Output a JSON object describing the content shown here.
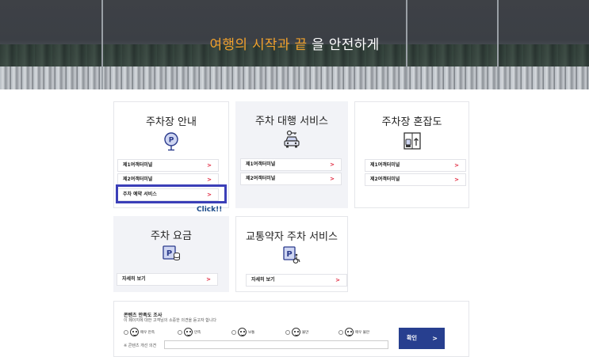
{
  "hero": {
    "title_highlight": "여행의 시작과 끝",
    "title_rest": "을 안전하게"
  },
  "cards": {
    "parking_guide": {
      "title": "주차장 안내",
      "links": [
        "제1여객터미널",
        "제2여객터미널",
        "주차 예약 서비스"
      ]
    },
    "valet": {
      "title": "주차 대행 서비스",
      "links": [
        "제1여객터미널",
        "제2여객터미널"
      ]
    },
    "congestion": {
      "title": "주차장 혼잡도",
      "links": [
        "제1여객터미널",
        "제2여객터미널"
      ]
    },
    "fee": {
      "title": "주차 요금",
      "links": [
        "자세히 보기"
      ]
    },
    "disabled": {
      "title": "교통약자 주차 서비스",
      "links": [
        "자세히 보기"
      ]
    }
  },
  "annotation": {
    "click_label": "Click!!"
  },
  "survey": {
    "title": "콘텐츠 만족도 조사",
    "subtitle": "이 페이지에 대한 고객님의 소중한 의견을 듣고자 합니다",
    "options": [
      "매우 만족",
      "만족",
      "보통",
      "불만",
      "매우 불만"
    ],
    "improve_label": "※ 콘텐츠 개선 의견",
    "submit_label": "확인"
  },
  "colors": {
    "accent_orange": "#f0a12c",
    "arrow_red": "#e0233b",
    "submit_blue": "#273f8f",
    "highlight_blue": "#3b3fb8"
  },
  "icons": [
    "parking-pin-icon",
    "valet-car-icon",
    "congestion-icon",
    "parking-fee-icon",
    "disabled-parking-icon",
    "chevron-right-icon"
  ]
}
